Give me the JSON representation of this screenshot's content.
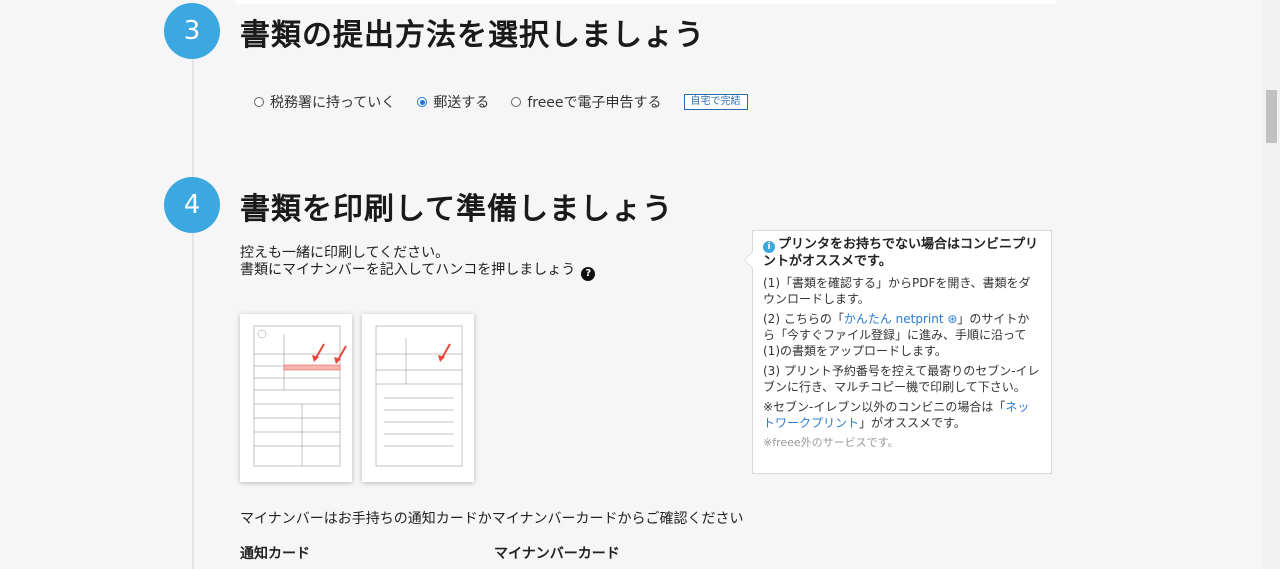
{
  "step3": {
    "number": "3",
    "title": "書類の提出方法を選択しましょう",
    "options": [
      {
        "label": "税務署に持っていく",
        "checked": false
      },
      {
        "label": "郵送する",
        "checked": true
      },
      {
        "label": "freeeで電子申告する",
        "checked": false
      }
    ],
    "badge": "自宅で完結"
  },
  "step4": {
    "number": "4",
    "title": "書類を印刷して準備しましょう",
    "intro_line1": "控えも一緒に印刷してください。",
    "intro_line2": "書類にマイナンバーを記入してハンコを押しましょう",
    "help_glyph": "?"
  },
  "tip": {
    "title": "プリンタをお持ちでない場合はコンビニプリントがオススメです。",
    "info_glyph": "i",
    "step1": "(1)「書類を確認する」からPDFを開き、書類をダウンロードします。",
    "step2_prefix": "(2) こちらの「",
    "step2_link": "かんたん netprint",
    "step2_suffix": "」のサイトから「今すぐファイル登録」に進み、手順に沿って(1)の書類をアップロードします。",
    "step3": "(3) プリント予約番号を控えて最寄りのセブン-イレブンに行き、マルチコピー機で印刷して下さい。",
    "other_prefix": "※セブン-イレブン以外のコンビニの場合は「",
    "other_link": "ネットワークプリント",
    "other_suffix": "」がオススメです。",
    "note": "※freee外のサービスです。"
  },
  "mynumber": {
    "text": "マイナンバーはお手持ちの通知カードかマイナンバーカードからご確認ください",
    "card1": "通知カード",
    "card2": "マイナンバーカード"
  },
  "colors": {
    "accent": "#3ba8df",
    "link": "#2b7bd6",
    "highlight": "#e8483c"
  }
}
